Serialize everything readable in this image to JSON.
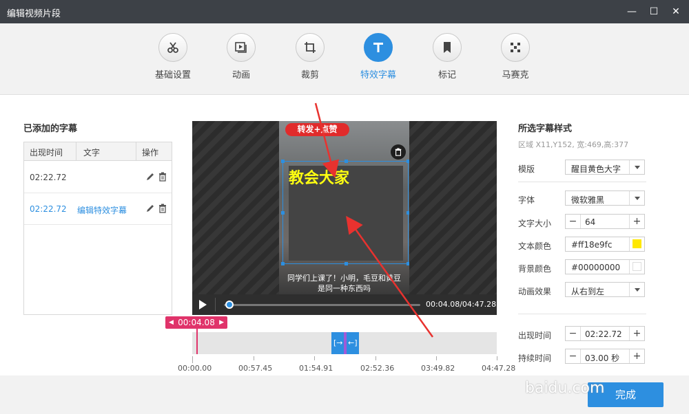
{
  "window": {
    "title": "编辑视频片段",
    "minimize_label": "—",
    "maximize_label": "☐",
    "close_label": "✕"
  },
  "toolbar": {
    "items": [
      {
        "label": "基础设置",
        "icon": "scissors-icon"
      },
      {
        "label": "动画",
        "icon": "animation-icon"
      },
      {
        "label": "裁剪",
        "icon": "crop-icon"
      },
      {
        "label": "特效字幕",
        "icon": "text-t-icon",
        "active": true
      },
      {
        "label": "标记",
        "icon": "bookmark-icon"
      },
      {
        "label": "马赛克",
        "icon": "mosaic-icon"
      }
    ]
  },
  "subtitles": {
    "title": "已添加的字幕",
    "columns": [
      "出现时间",
      "文字",
      "操作"
    ],
    "rows": [
      {
        "time": "02:22.72",
        "text": ""
      },
      {
        "time": "02:22.72",
        "text": "编辑特效字幕"
      }
    ]
  },
  "video": {
    "banner_text": "转发+点赞",
    "overlay_caption": "教会大家",
    "subtitle_line1": "同学们上课了！小明，毛豆和黄豆",
    "subtitle_line2": "是同一种东西吗",
    "time_readout": "00:04.08/04:47.28",
    "progress_fraction": 0.014
  },
  "timeline": {
    "playhead_label": "00:04.08",
    "clip_left_icon": "[→",
    "clip_right_icon": "←]",
    "ticks": [
      "00:00.00",
      "00:57.45",
      "01:54.91",
      "02:52.36",
      "03:49.82",
      "04:47.28"
    ]
  },
  "style_panel": {
    "title": "所选字幕样式",
    "region_info": "区域 X11,Y152, 宽:469,高:377",
    "template_label": "模版",
    "template_value": "醒目黄色大字",
    "font_label": "字体",
    "font_value": "微软雅黑",
    "size_label": "文字大小",
    "size_value": "64",
    "text_color_label": "文本颜色",
    "text_color_value": "#ff18e9fc",
    "text_color_swatch": "#ffe800",
    "bg_color_label": "背景颜色",
    "bg_color_value": "#00000000",
    "bg_color_swatch": "#ffffff",
    "animation_label": "动画效果",
    "animation_value": "从右到左",
    "start_label": "出现时间",
    "start_value": "02:22.72",
    "duration_label": "持续时间",
    "duration_value": "03.00 秒"
  },
  "footer": {
    "done_label": "完成",
    "watermark": "baidu.com"
  },
  "colors": {
    "accent": "#2d8fe0",
    "playhead": "#e0336a",
    "titlebar": "#3d4147",
    "annotation_arrow": "#e8322f"
  }
}
